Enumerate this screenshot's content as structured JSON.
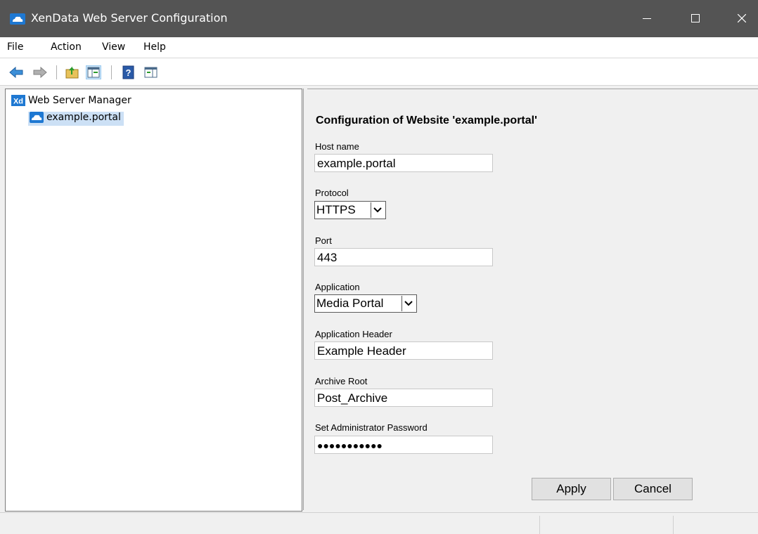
{
  "window": {
    "title": "XenData Web Server Configuration"
  },
  "menu": {
    "file": "File",
    "action": "Action",
    "view": "View",
    "help": "Help"
  },
  "toolbar": {
    "icons": [
      "back-arrow-icon",
      "forward-arrow-icon",
      "up-folder-icon",
      "show-hide-tree-icon",
      "help-icon",
      "action-pane-icon"
    ]
  },
  "tree": {
    "root_label": "Web Server Manager",
    "child_label": "example.portal"
  },
  "form": {
    "title": "Configuration of Website 'example.portal'",
    "host_name_label": "Host name",
    "host_name_value": "example.portal",
    "protocol_label": "Protocol",
    "protocol_value": "HTTPS",
    "port_label": "Port",
    "port_value": "443",
    "application_label": "Application",
    "application_value": "Media Portal",
    "app_header_label": "Application Header",
    "app_header_value": "Example Header",
    "archive_root_label": "Archive Root",
    "archive_root_value": "Post_Archive",
    "password_label": "Set Administrator Password",
    "password_value": "●●●●●●●●●●●",
    "apply_label": "Apply",
    "cancel_label": "Cancel"
  },
  "colors": {
    "titlebar": "#545454",
    "selection": "#cce0f5",
    "cloud_icon": "#1e78d2",
    "pane_background": "#f0f0f0"
  }
}
